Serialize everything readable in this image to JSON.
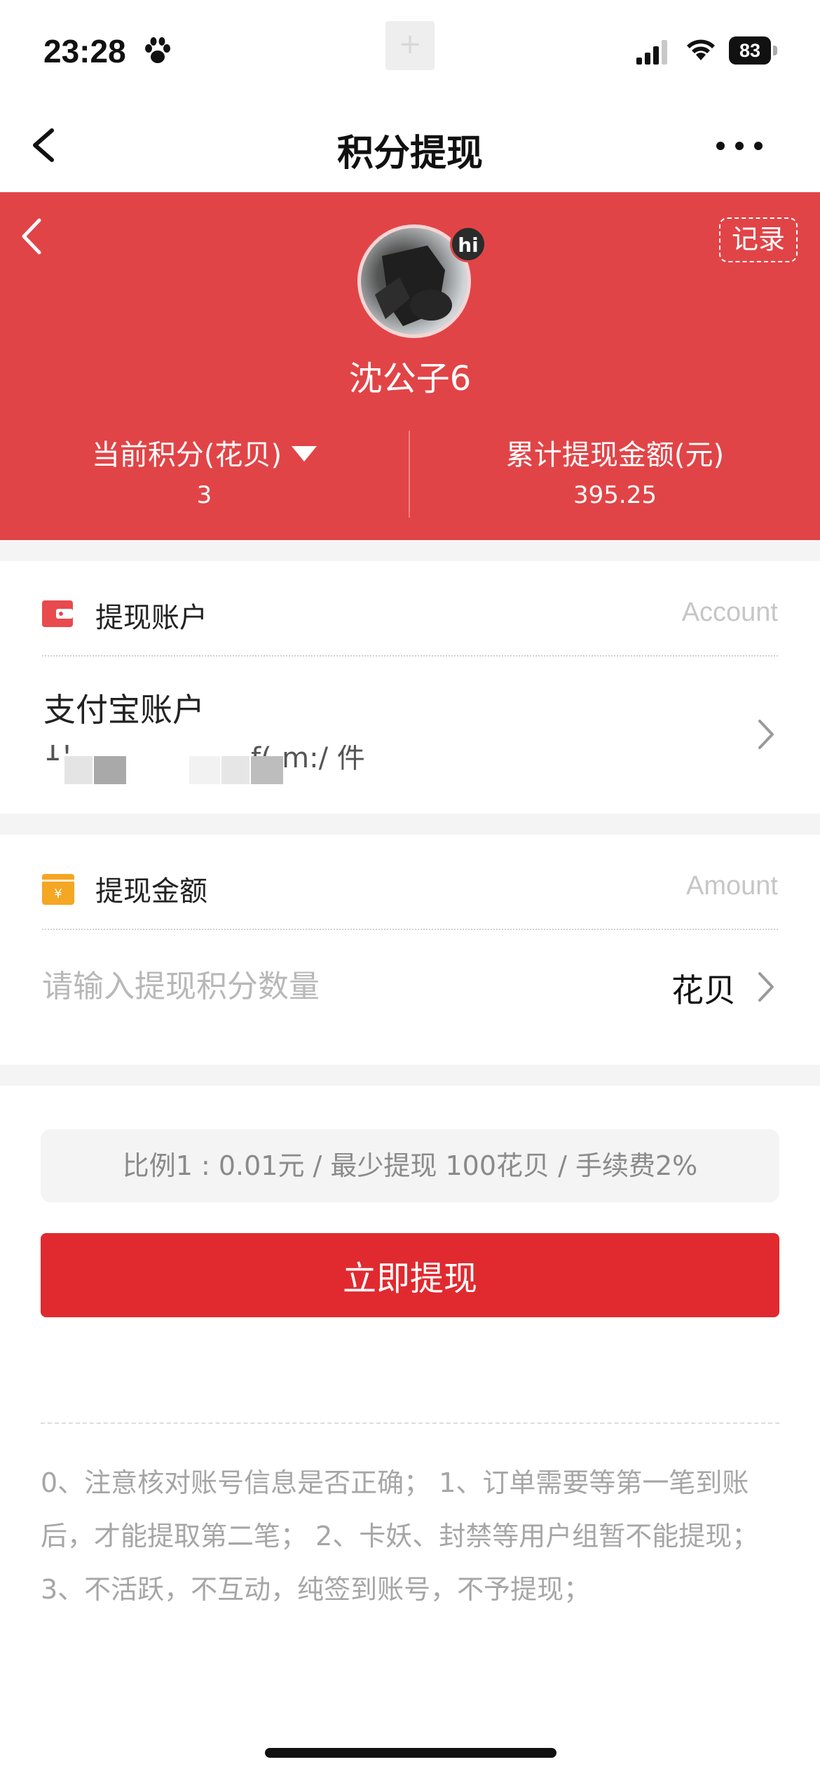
{
  "status_bar": {
    "time": "23:28",
    "battery": "83",
    "center_glyph": "+"
  },
  "nav": {
    "title": "积分提现"
  },
  "header": {
    "record_label": "记录",
    "avatar_badge": "hi",
    "username": "沈公子6",
    "points_label": "当前积分(花贝)",
    "points_value": "3",
    "total_label": "累计提现金额(元)",
    "total_value": "395.25",
    "accent_color": "#e14447"
  },
  "account_section": {
    "title": "提现账户",
    "hint": "Account",
    "account_name": "支付宝账户",
    "account_fragment_1": "1!",
    "account_fragment_2": "f(-m:/ 件"
  },
  "amount_section": {
    "title": "提现金额",
    "hint": "Amount",
    "placeholder": "请输入提现积分数量",
    "value": "",
    "unit": "花贝"
  },
  "rules": {
    "ratio_text": "比例1 : 0.01元 / 最少提现 100花贝 / 手续费2%",
    "submit_label": "立即提现",
    "notes": "0、注意核对账号信息是否正确； 1、订单需要等第一笔到账后，才能提取第二笔； 2、卡妖、封禁等用户组暂不能提现； 3、不活跃，不互动，纯签到账号，不予提现；"
  }
}
